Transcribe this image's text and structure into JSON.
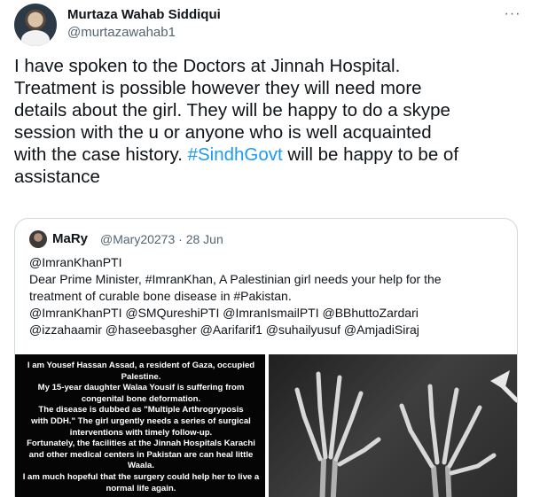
{
  "author": {
    "name": "Murtaza Wahab Siddiqui",
    "handle": "@murtazawahab1"
  },
  "more_label": "···",
  "tweet": {
    "lines": [
      "I have spoken to the Doctors at Jinnah Hospital.",
      "Treatment is possible however they will need more",
      "details about the girl. They will be happy to do a skype",
      "session with the u or anyone who is well acquainted",
      "assistance"
    ],
    "line5_prefix": "with the case history. ",
    "hashtag": "#SindhGovt",
    "line5_suffix": " will be happy to be of"
  },
  "quoted": {
    "name": "MaRy",
    "handle_date": "@Mary20273 · 28 Jun",
    "lines": [
      "@ImranKhanPTI",
      "Dear Prime Minister, #ImranKhan, A Palestinian girl needs your help for the",
      "treatment of curable bone disease in #Pakistan.",
      "@ImranKhanPTI @SMQureshiPTI @ImranIsmailPTI @BBhuttoZardari",
      "@izzahaamir @haseebasgher @Aarifarif1 @suhailyusuf @AmjadiSiraj"
    ],
    "media_text": [
      "I am Yousef Hassan Assad, a resident of Gaza, occupied",
      "Palestine.",
      "My 15-year daughter Walaa Yousif is suffering from",
      "congenital bone deformation.",
      "The disease is dubbed as \"Multiple Arthrogryposis",
      "with DDH.\" The girl urgently needs a series of surgical",
      "interventions with timely follow-up.",
      "Fortunately, the facilities at the Jinnah Hospitals Karachi",
      "and other medical centers in Pakistan are can heal little",
      "Waala.",
      "I am much hopeful that the surgery could help her to live a",
      "normal life again."
    ]
  },
  "colors": {
    "text": "#0f1419",
    "muted": "#536471",
    "link": "#1d9bf0",
    "border": "#cfd9de"
  },
  "icons": {
    "more": "more-horizontal-icon",
    "xray_image": "x-ray-hands-image"
  }
}
